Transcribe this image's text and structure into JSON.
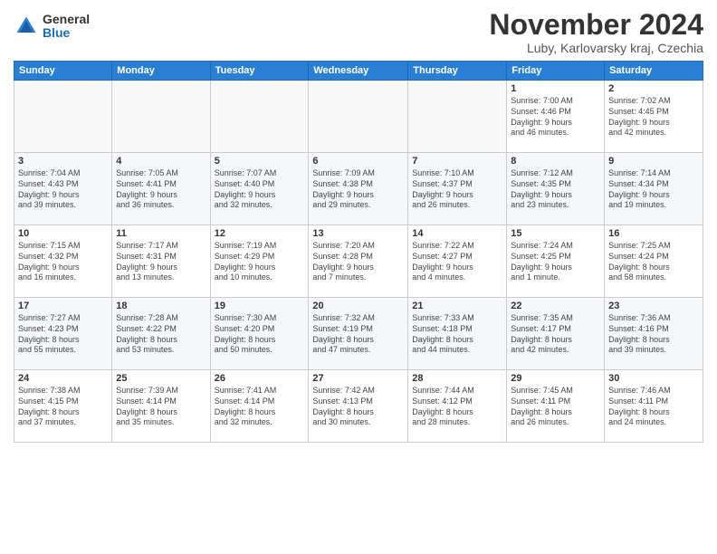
{
  "header": {
    "logo_general": "General",
    "logo_blue": "Blue",
    "month_title": "November 2024",
    "location": "Luby, Karlovarsky kraj, Czechia"
  },
  "weekdays": [
    "Sunday",
    "Monday",
    "Tuesday",
    "Wednesday",
    "Thursday",
    "Friday",
    "Saturday"
  ],
  "weeks": [
    [
      {
        "day": "",
        "info": ""
      },
      {
        "day": "",
        "info": ""
      },
      {
        "day": "",
        "info": ""
      },
      {
        "day": "",
        "info": ""
      },
      {
        "day": "",
        "info": ""
      },
      {
        "day": "1",
        "info": "Sunrise: 7:00 AM\nSunset: 4:46 PM\nDaylight: 9 hours\nand 46 minutes."
      },
      {
        "day": "2",
        "info": "Sunrise: 7:02 AM\nSunset: 4:45 PM\nDaylight: 9 hours\nand 42 minutes."
      }
    ],
    [
      {
        "day": "3",
        "info": "Sunrise: 7:04 AM\nSunset: 4:43 PM\nDaylight: 9 hours\nand 39 minutes."
      },
      {
        "day": "4",
        "info": "Sunrise: 7:05 AM\nSunset: 4:41 PM\nDaylight: 9 hours\nand 36 minutes."
      },
      {
        "day": "5",
        "info": "Sunrise: 7:07 AM\nSunset: 4:40 PM\nDaylight: 9 hours\nand 32 minutes."
      },
      {
        "day": "6",
        "info": "Sunrise: 7:09 AM\nSunset: 4:38 PM\nDaylight: 9 hours\nand 29 minutes."
      },
      {
        "day": "7",
        "info": "Sunrise: 7:10 AM\nSunset: 4:37 PM\nDaylight: 9 hours\nand 26 minutes."
      },
      {
        "day": "8",
        "info": "Sunrise: 7:12 AM\nSunset: 4:35 PM\nDaylight: 9 hours\nand 23 minutes."
      },
      {
        "day": "9",
        "info": "Sunrise: 7:14 AM\nSunset: 4:34 PM\nDaylight: 9 hours\nand 19 minutes."
      }
    ],
    [
      {
        "day": "10",
        "info": "Sunrise: 7:15 AM\nSunset: 4:32 PM\nDaylight: 9 hours\nand 16 minutes."
      },
      {
        "day": "11",
        "info": "Sunrise: 7:17 AM\nSunset: 4:31 PM\nDaylight: 9 hours\nand 13 minutes."
      },
      {
        "day": "12",
        "info": "Sunrise: 7:19 AM\nSunset: 4:29 PM\nDaylight: 9 hours\nand 10 minutes."
      },
      {
        "day": "13",
        "info": "Sunrise: 7:20 AM\nSunset: 4:28 PM\nDaylight: 9 hours\nand 7 minutes."
      },
      {
        "day": "14",
        "info": "Sunrise: 7:22 AM\nSunset: 4:27 PM\nDaylight: 9 hours\nand 4 minutes."
      },
      {
        "day": "15",
        "info": "Sunrise: 7:24 AM\nSunset: 4:25 PM\nDaylight: 9 hours\nand 1 minute."
      },
      {
        "day": "16",
        "info": "Sunrise: 7:25 AM\nSunset: 4:24 PM\nDaylight: 8 hours\nand 58 minutes."
      }
    ],
    [
      {
        "day": "17",
        "info": "Sunrise: 7:27 AM\nSunset: 4:23 PM\nDaylight: 8 hours\nand 55 minutes."
      },
      {
        "day": "18",
        "info": "Sunrise: 7:28 AM\nSunset: 4:22 PM\nDaylight: 8 hours\nand 53 minutes."
      },
      {
        "day": "19",
        "info": "Sunrise: 7:30 AM\nSunset: 4:20 PM\nDaylight: 8 hours\nand 50 minutes."
      },
      {
        "day": "20",
        "info": "Sunrise: 7:32 AM\nSunset: 4:19 PM\nDaylight: 8 hours\nand 47 minutes."
      },
      {
        "day": "21",
        "info": "Sunrise: 7:33 AM\nSunset: 4:18 PM\nDaylight: 8 hours\nand 44 minutes."
      },
      {
        "day": "22",
        "info": "Sunrise: 7:35 AM\nSunset: 4:17 PM\nDaylight: 8 hours\nand 42 minutes."
      },
      {
        "day": "23",
        "info": "Sunrise: 7:36 AM\nSunset: 4:16 PM\nDaylight: 8 hours\nand 39 minutes."
      }
    ],
    [
      {
        "day": "24",
        "info": "Sunrise: 7:38 AM\nSunset: 4:15 PM\nDaylight: 8 hours\nand 37 minutes."
      },
      {
        "day": "25",
        "info": "Sunrise: 7:39 AM\nSunset: 4:14 PM\nDaylight: 8 hours\nand 35 minutes."
      },
      {
        "day": "26",
        "info": "Sunrise: 7:41 AM\nSunset: 4:14 PM\nDaylight: 8 hours\nand 32 minutes."
      },
      {
        "day": "27",
        "info": "Sunrise: 7:42 AM\nSunset: 4:13 PM\nDaylight: 8 hours\nand 30 minutes."
      },
      {
        "day": "28",
        "info": "Sunrise: 7:44 AM\nSunset: 4:12 PM\nDaylight: 8 hours\nand 28 minutes."
      },
      {
        "day": "29",
        "info": "Sunrise: 7:45 AM\nSunset: 4:11 PM\nDaylight: 8 hours\nand 26 minutes."
      },
      {
        "day": "30",
        "info": "Sunrise: 7:46 AM\nSunset: 4:11 PM\nDaylight: 8 hours\nand 24 minutes."
      }
    ]
  ]
}
